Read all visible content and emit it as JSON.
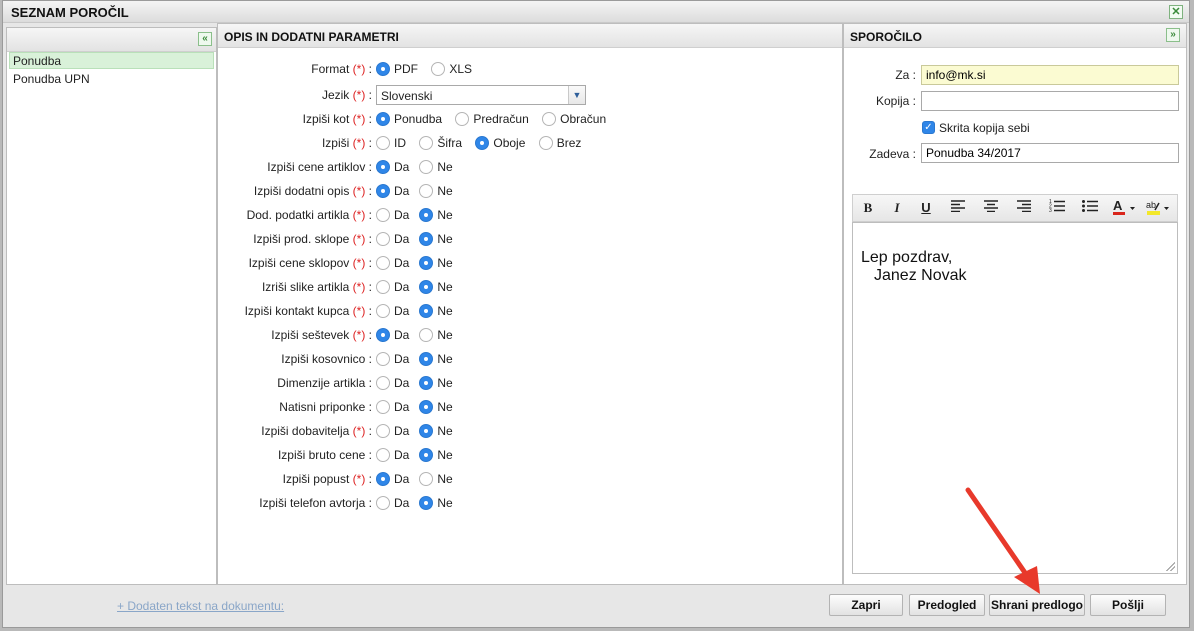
{
  "window": {
    "title": "SEZNAM POROČIL",
    "close_icon": "close-icon"
  },
  "reports": {
    "items": [
      {
        "label": "Ponudba",
        "selected": true
      },
      {
        "label": "Ponudba UPN",
        "selected": false
      }
    ]
  },
  "params": {
    "title": "OPIS IN DODATNI PARAMETRI",
    "format": {
      "label": "Format",
      "required": "(*)",
      "options": [
        "PDF",
        "XLS"
      ],
      "selected": "PDF"
    },
    "jezik": {
      "label": "Jezik",
      "required": "(*)",
      "value": "Slovenski"
    },
    "izpisi_kot": {
      "label": "Izpiši kot",
      "required": "(*)",
      "options": [
        "Ponudba",
        "Predračun",
        "Obračun"
      ],
      "selected": "Ponudba"
    },
    "izpisi": {
      "label": "Izpiši",
      "required": "(*)",
      "options": [
        "ID",
        "Šifra",
        "Oboje",
        "Brez"
      ],
      "selected": "Oboje"
    },
    "yes_no": [
      {
        "label": "Izpiši cene artiklov",
        "required": "",
        "yes": "Da",
        "no": "Ne",
        "selected": "Da"
      },
      {
        "label": "Izpiši dodatni opis",
        "required": "(*)",
        "yes": "Da",
        "no": "Ne",
        "selected": "Da"
      },
      {
        "label": "Dod. podatki artikla",
        "required": "(*)",
        "yes": "Da",
        "no": "Ne",
        "selected": "Ne"
      },
      {
        "label": "Izpiši prod. sklope",
        "required": "(*)",
        "yes": "Da",
        "no": "Ne",
        "selected": "Ne"
      },
      {
        "label": "Izpiši cene sklopov",
        "required": "(*)",
        "yes": "Da",
        "no": "Ne",
        "selected": "Ne"
      },
      {
        "label": "Izriši slike artikla",
        "required": "(*)",
        "yes": "Da",
        "no": "Ne",
        "selected": "Ne"
      },
      {
        "label": "Izpiši kontakt kupca",
        "required": "(*)",
        "yes": "Da",
        "no": "Ne",
        "selected": "Ne"
      },
      {
        "label": "Izpiši seštevek",
        "required": "(*)",
        "yes": "Da",
        "no": "Ne",
        "selected": "Da"
      },
      {
        "label": "Izpiši kosovnico",
        "required": "",
        "yes": "Da",
        "no": "Ne",
        "selected": "Ne"
      },
      {
        "label": "Dimenzije artikla",
        "required": "",
        "yes": "Da",
        "no": "Ne",
        "selected": "Ne"
      },
      {
        "label": "Natisni priponke",
        "required": "",
        "yes": "Da",
        "no": "Ne",
        "selected": "Ne"
      },
      {
        "label": "Izpiši dobavitelja",
        "required": "(*)",
        "yes": "Da",
        "no": "Ne",
        "selected": "Ne"
      },
      {
        "label": "Izpiši bruto cene",
        "required": "",
        "yes": "Da",
        "no": "Ne",
        "selected": "Ne"
      },
      {
        "label": "Izpiši popust",
        "required": "(*)",
        "yes": "Da",
        "no": "Ne",
        "selected": "Da"
      },
      {
        "label": "Izpiši telefon avtorja",
        "required": "",
        "yes": "Da",
        "no": "Ne",
        "selected": "Ne"
      }
    ]
  },
  "message": {
    "title": "SPOROČILO",
    "za_label": "Za :",
    "za_value": "info@mk.si",
    "kopija_label": "Kopija :",
    "kopija_value": "",
    "bcc_label": "Skrita kopija sebi",
    "bcc_checked": true,
    "zadeva_label": "Zadeva :",
    "zadeva_value": "Ponudba 34/2017",
    "toolbar": [
      "bold-icon",
      "italic-icon",
      "underline-icon",
      "align-left-icon",
      "align-center-icon",
      "align-right-icon",
      "ordered-list-icon",
      "bullet-list-icon",
      "text-color-icon",
      "highlight-color-icon"
    ],
    "body_line1": "Lep pozdrav,",
    "body_line2": "Janez Novak"
  },
  "footer": {
    "link": "+ Dodaten tekst na dokumentu:",
    "buttons": {
      "zapri": "Zapri",
      "predogled": "Predogled",
      "shrani": "Shrani predlogo",
      "poslji": "Pošlji"
    }
  },
  "colors": {
    "accent_blue": "#2f86e8",
    "required_red": "#d22222",
    "arrow_red": "#e8392b",
    "selection_green": "#d9f1d9"
  }
}
